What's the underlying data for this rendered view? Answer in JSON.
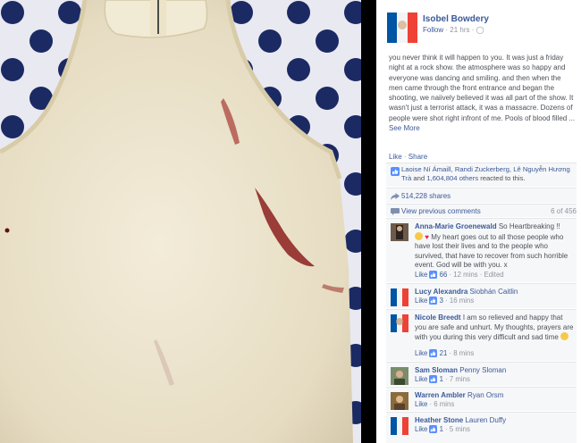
{
  "post": {
    "author": "Isobel Bowdery",
    "follow": "Follow",
    "time": "· 21 hrs ·",
    "body": "you never think it will happen to you. It was just a friday night at a rock show. the atmosphere was so happy and everyone was dancing and smiling. and then when the men came through the front entrance and began the shooting, we naiively believed it was all part of the show. It wasn't just a terrorist attack, it was a massacre. Dozens of people were shot right infront of me. Pools of blood filled ...",
    "see_more": "See More"
  },
  "actions": {
    "like": "Like",
    "sep": " · ",
    "share": "Share"
  },
  "reactions": {
    "names": "Laoise Ní Ámaill, Randi Zuckerberg, Lê Nguyễn Hương Trà",
    "and": " and ",
    "others": "1,604,804 others",
    "suffix": " reacted to this."
  },
  "shares": "514,228 shares",
  "previous": {
    "label": "View previous comments",
    "count": "6 of 456"
  },
  "comments": [
    {
      "name": "Anna-Marie Groenewald",
      "text": "So Heartbreaking !!",
      "text2": "My heart goes out to all those people who have lost their lives and to the people who survived, that have to recover from such horrible event. God will be with you. x",
      "like": "Like",
      "likes": "66",
      "time": "· 12 mins · Edited"
    },
    {
      "name": "Lucy Alexandra",
      "tag": "Siobhán Caitlin",
      "like": "Like",
      "likes": "3",
      "time": "· 16 mins"
    },
    {
      "name": "Nicole Breedt",
      "text": "I am so relieved and happy that you are safe and unhurt. My thoughts, prayers are with you during this very difficult and sad time",
      "like": "Like",
      "likes": "21",
      "time": "· 8 mins"
    },
    {
      "name": "Sam Sloman",
      "tag": "Penny Sloman",
      "like": "Like",
      "likes": "1",
      "time": "· 7 mins"
    },
    {
      "name": "Warren Ambler",
      "tag": "Ryan Orsm",
      "like": "Like",
      "time": "· 6 mins"
    },
    {
      "name": "Heather Stone",
      "tag": "Lauren Duffy",
      "like": "Like",
      "likes": "1",
      "time": "· 5 mins"
    }
  ],
  "colors": {
    "link": "#3b5998",
    "muted": "#90949c",
    "panel": "#f6f7f9",
    "french_blue": "#0055a4",
    "french_red": "#ef4135"
  }
}
